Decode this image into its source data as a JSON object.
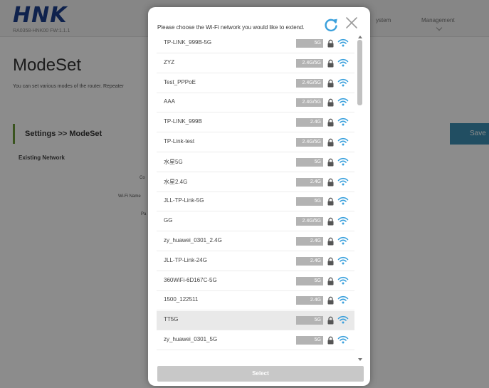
{
  "background": {
    "logo": "HNK",
    "firmware": "RA0358-HNK00 FW:1.1.1",
    "nav": [
      "ystem",
      "Management"
    ],
    "page_title": "ModeSet",
    "page_desc": "You can set various modes of the router. Repeater",
    "settings_header": "Settings >> ModeSet",
    "existing_network": "Existing Network",
    "labels": [
      "Co",
      "Wi-Fi Name",
      "Pa"
    ],
    "save_label": "Save"
  },
  "modal": {
    "title": "Please choose the Wi-Fi network you would like to extend.",
    "select_label": "Select",
    "networks": [
      {
        "ssid": "TP-LINK_999B-5G",
        "band": "5G"
      },
      {
        "ssid": "ZYZ",
        "band": "2.4G/5G"
      },
      {
        "ssid": "Test_PPPoE",
        "band": "2.4G/5G"
      },
      {
        "ssid": "AAA",
        "band": "2.4G/5G"
      },
      {
        "ssid": "TP-LINK_999B",
        "band": "2.4G"
      },
      {
        "ssid": "TP-Link-test",
        "band": "2.4G/5G"
      },
      {
        "ssid": "水星5G",
        "band": "5G"
      },
      {
        "ssid": "水星2.4G",
        "band": "2.4G"
      },
      {
        "ssid": "JLL-TP-Link-5G",
        "band": "5G"
      },
      {
        "ssid": "GG",
        "band": "2.4G/5G"
      },
      {
        "ssid": "zy_huawei_0301_2.4G",
        "band": "2.4G"
      },
      {
        "ssid": "JLL-TP-Link-24G",
        "band": "2.4G"
      },
      {
        "ssid": "360WiFi-6D167C-5G",
        "band": "5G"
      },
      {
        "ssid": "1500_122511",
        "band": "2.4G"
      },
      {
        "ssid": "TT5G",
        "band": "5G",
        "selected": true
      },
      {
        "ssid": "zy_huawei_0301_5G",
        "band": "5G"
      }
    ]
  },
  "colors": {
    "brand": "#1d3f8c",
    "accent": "#3d8fb2",
    "wifi_icon": "#3aa0dc",
    "band_badge": "#b3b3b3"
  },
  "icons": {
    "refresh": "refresh-icon",
    "close": "close-icon",
    "lock": "lock-icon",
    "wifi": "wifi-icon"
  }
}
